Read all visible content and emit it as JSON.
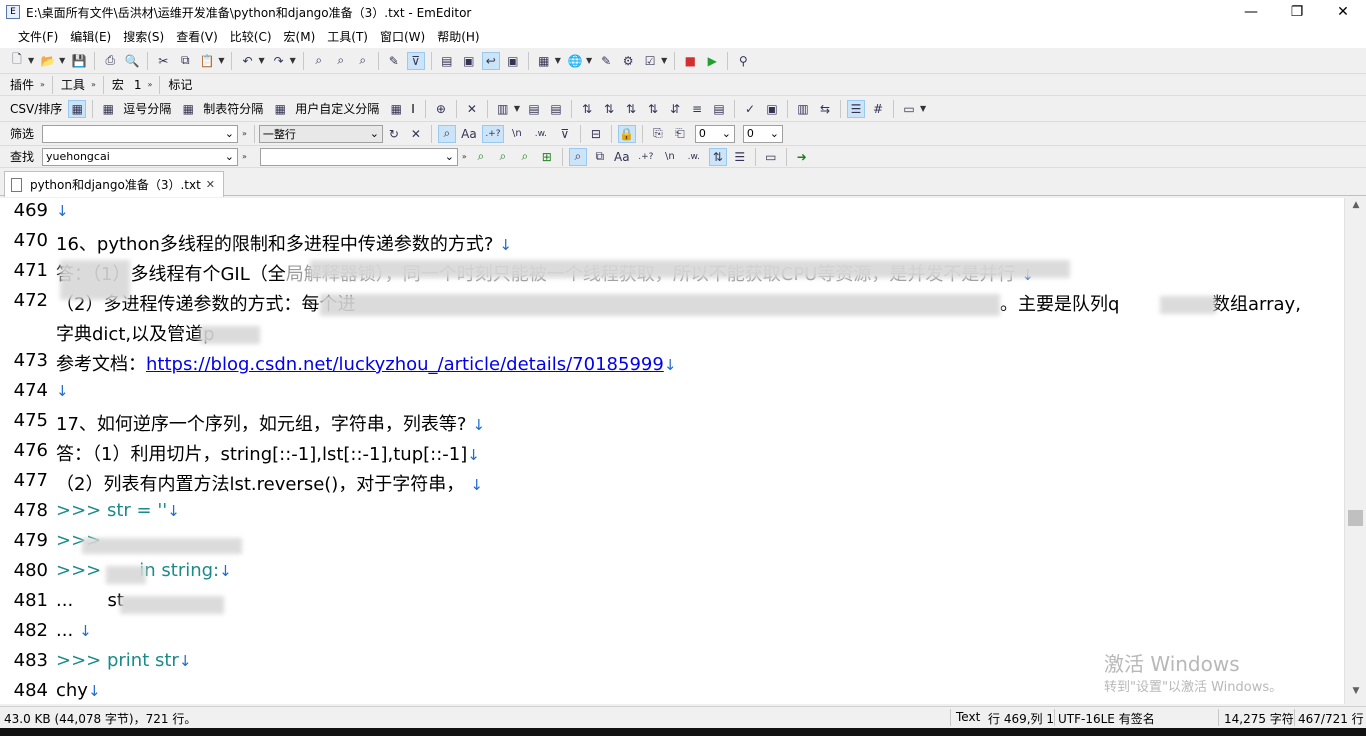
{
  "window": {
    "title": "E:\\桌面所有文件\\岳洪材\\运维开发准备\\python和django准备（3）.txt - EmEditor",
    "minimize": "—",
    "restore": "❐",
    "close": "✕"
  },
  "menu": [
    "文件(F)",
    "编辑(E)",
    "搜索(S)",
    "查看(V)",
    "比较(C)",
    "宏(M)",
    "工具(T)",
    "窗口(W)",
    "帮助(H)"
  ],
  "toolbar2": {
    "plugins": "插件",
    "tools": "工具",
    "macros": "宏",
    "macro_num": "1",
    "bookmarks": "标记"
  },
  "csvbar": {
    "csv_sort": "CSV/排序",
    "comma": "逗号分隔",
    "tab": "制表符分隔",
    "user": "用户自定义分隔",
    "cursor": "I"
  },
  "filterbar": {
    "label": "筛选",
    "mode": "一整行",
    "col1": "0",
    "col2": "0",
    "regex_dot": ".+?",
    "newline": "\\n",
    "word": ".w."
  },
  "findbar": {
    "label": "查找",
    "value": "yuehongcai",
    "regex_dot": ".+?",
    "newline": "\\n",
    "word": ".w."
  },
  "tab": {
    "label": "python和django准备（3）.txt"
  },
  "lines": [
    {
      "num": "469",
      "text": ""
    },
    {
      "num": "470",
      "text": "16、python多线程的限制和多进程中传递参数的方式?"
    },
    {
      "num": "471",
      "text": "答：（1）多线程有个GIL（全",
      "mid": "局解释器锁），同一个时刻只能被一个线程获取，所以不能获取CPU等资源，是并发不是并行"
    },
    {
      "num": "472",
      "text": "（2）多进程传递参数的方式：每个进",
      "tail": "。主要是队列q",
      "tail2": "数组array,",
      "wrap": "字典dict,以及管道p"
    },
    {
      "num": "473",
      "text": "参考文档：",
      "link": "https://blog.csdn.net/luckyzhou_/article/details/70185999"
    },
    {
      "num": "474",
      "text": ""
    },
    {
      "num": "475",
      "text": "17、如何逆序一个序列，如元组，字符串，列表等?"
    },
    {
      "num": "476",
      "text": "答：（1）利用切片，string[::-1],lst[::-1],tup[::-1]"
    },
    {
      "num": "477",
      "text": "（2）列表有内置方法lst.reverse()，对于字符串，"
    },
    {
      "num": "478",
      "text": ">>> str = ''"
    },
    {
      "num": "479",
      "text": ">>>"
    },
    {
      "num": "480",
      "text": ">>>",
      "text2": "in string:"
    },
    {
      "num": "481",
      "text": "...      st"
    },
    {
      "num": "482",
      "text": "..."
    },
    {
      "num": "483",
      "text": ">>> print str"
    },
    {
      "num": "484",
      "text": "chy"
    }
  ],
  "newline_mark": "↓",
  "watermark": {
    "line1": "激活 Windows",
    "line2": "转到\"设置\"以激活 Windows。"
  },
  "status": {
    "size": "43.0 KB (44,078 字节)，721 行。",
    "mode": "Text",
    "position": "行 469,列 1",
    "encoding": "UTF-16LE 有签名",
    "chars": "14,275 字符",
    "lines": "467/721 行"
  }
}
